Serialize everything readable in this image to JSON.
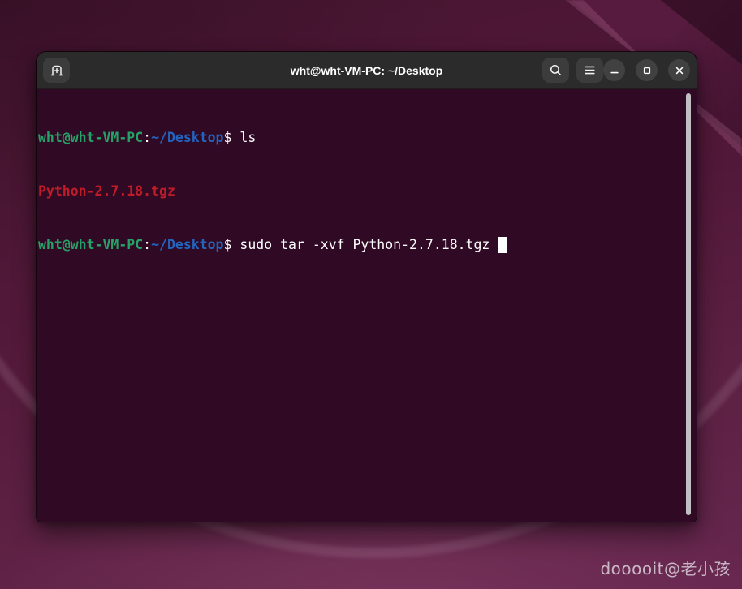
{
  "window": {
    "title": "wht@wht-VM-PC: ~/Desktop"
  },
  "terminal": {
    "prompt_user_host": "wht@wht-VM-PC",
    "prompt_separator": ":",
    "prompt_path": "~/Desktop",
    "prompt_symbol": "$",
    "command_1": "ls",
    "output_1": "Python-2.7.18.tgz",
    "command_2": "sudo tar -xvf Python-2.7.18.tgz"
  },
  "watermark": {
    "text": "dooooit@老小孩"
  },
  "colors": {
    "term-bg": "#300a24",
    "titlebar-bg": "#2b2b2b",
    "term-fg": "#ffffff",
    "term-green": "#26a269",
    "term-blue": "#2265c0",
    "term-red": "#c01c28"
  }
}
